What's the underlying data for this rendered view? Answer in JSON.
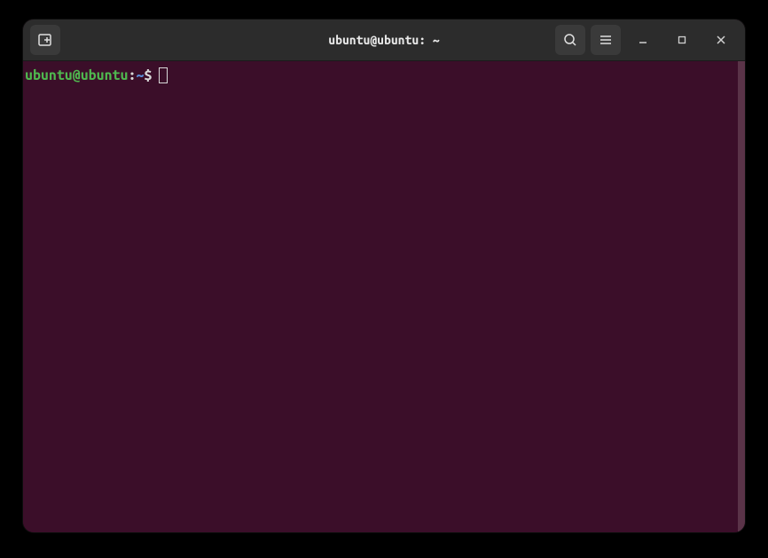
{
  "window": {
    "title": "ubuntu@ubuntu: ~"
  },
  "prompt": {
    "user_host": "ubuntu@ubuntu",
    "separator": ":",
    "path": "~",
    "symbol": "$"
  }
}
